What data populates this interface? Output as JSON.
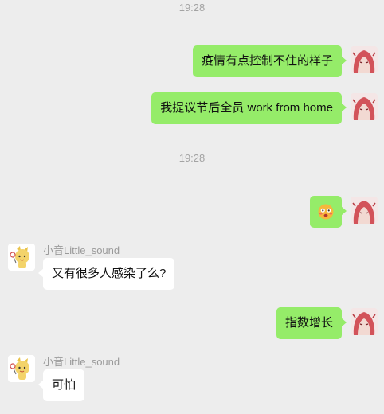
{
  "timestamps": [
    "19:28",
    "19:28"
  ],
  "messages": [
    {
      "text": "疫情有点控制不住的样子"
    },
    {
      "text": "我提议节后全员 work from home"
    },
    {
      "emoji": "flushed-face-emoji"
    },
    {
      "sender": "小音Little_sound",
      "text": "又有很多人感染了么?"
    },
    {
      "text": "指数增长"
    },
    {
      "sender": "小音Little_sound",
      "text": "可怕"
    }
  ],
  "colors": {
    "background": "#ededed",
    "own_bubble": "#95ec69",
    "other_bubble": "#ffffff",
    "timestamp": "#a3a3a3",
    "sender_name": "#9a9a9a"
  }
}
